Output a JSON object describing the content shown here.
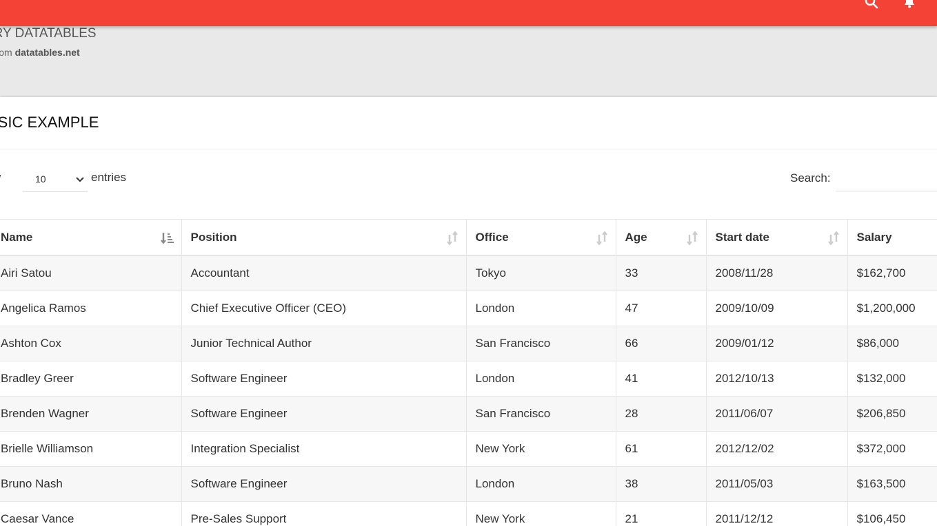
{
  "header": {
    "title": "ERY DATATABLES",
    "subtitle_prefix": "n from",
    "subtitle_link": "datatables.net",
    "accent_color": "#f44336",
    "icons": [
      "search-icon",
      "bell-icon"
    ]
  },
  "card": {
    "title": "ASIC EXAMPLE"
  },
  "controls": {
    "show_label": "how",
    "length_value": "10",
    "entries_label": "entries",
    "search_label": "Search:",
    "search_value": ""
  },
  "table": {
    "columns": [
      "Name",
      "Position",
      "Office",
      "Age",
      "Start date",
      "Salary"
    ],
    "sorted_column": "Name",
    "rows": [
      [
        "Airi Satou",
        "Accountant",
        "Tokyo",
        "33",
        "2008/11/28",
        "$162,700"
      ],
      [
        "Angelica Ramos",
        "Chief Executive Officer (CEO)",
        "London",
        "47",
        "2009/10/09",
        "$1,200,000"
      ],
      [
        "Ashton Cox",
        "Junior Technical Author",
        "San Francisco",
        "66",
        "2009/01/12",
        "$86,000"
      ],
      [
        "Bradley Greer",
        "Software Engineer",
        "London",
        "41",
        "2012/10/13",
        "$132,000"
      ],
      [
        "Brenden Wagner",
        "Software Engineer",
        "San Francisco",
        "28",
        "2011/06/07",
        "$206,850"
      ],
      [
        "Brielle Williamson",
        "Integration Specialist",
        "New York",
        "61",
        "2012/12/02",
        "$372,000"
      ],
      [
        "Bruno Nash",
        "Software Engineer",
        "London",
        "38",
        "2011/05/03",
        "$163,500"
      ],
      [
        "Caesar Vance",
        "Pre-Sales Support",
        "New York",
        "21",
        "2011/12/12",
        "$106,450"
      ]
    ]
  }
}
